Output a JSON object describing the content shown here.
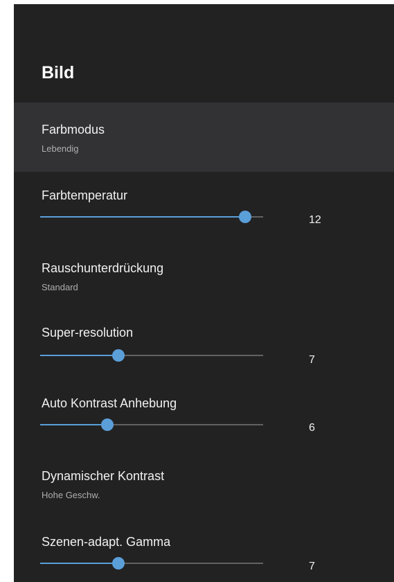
{
  "page_title": "Bild",
  "colors": {
    "background": "#222223",
    "selected_row": "#323234",
    "accent": "#5b9fd9",
    "track": "#626264"
  },
  "settings": [
    {
      "label": "Farbmodus",
      "value": "Lebendig",
      "type": "option",
      "selected": true
    },
    {
      "label": "Farbtemperatur",
      "value": "12",
      "type": "slider",
      "level_percent": 92
    },
    {
      "label": "Rauschunterdrückung",
      "value": "Standard",
      "type": "option"
    },
    {
      "label": "Super-resolution",
      "value": "7",
      "type": "slider",
      "level_percent": 35
    },
    {
      "label": "Auto Kontrast Anhebung",
      "value": "6",
      "type": "slider",
      "level_percent": 30
    },
    {
      "label": "Dynamischer Kontrast",
      "value": "Hohe Geschw.",
      "type": "option"
    },
    {
      "label": "Szenen-adapt. Gamma",
      "value": "7",
      "type": "slider",
      "level_percent": 35
    }
  ]
}
